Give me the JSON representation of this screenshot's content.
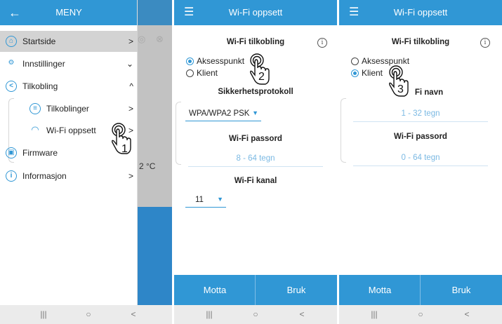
{
  "panel1": {
    "title": "MENY",
    "items": [
      {
        "label": "Startside",
        "chevron": ">",
        "icon": "home-icon",
        "glyph": "⌂"
      },
      {
        "label": "Innstillinger",
        "chevron": "⌄",
        "icon": "settings-icon",
        "glyph": "⚙"
      },
      {
        "label": "Tilkobling",
        "chevron": "^",
        "icon": "share-icon",
        "glyph": "<"
      },
      {
        "label": "Tilkoblinger",
        "chevron": ">",
        "icon": "list-icon",
        "glyph": "≡"
      },
      {
        "label": "Wi-Fi oppsett",
        "chevron": ">",
        "icon": "wifi-icon",
        "glyph": "◠"
      },
      {
        "label": "Firmware",
        "chevron": "",
        "icon": "firmware-icon",
        "glyph": "▣"
      },
      {
        "label": "Informasjon",
        "chevron": ">",
        "icon": "info-icon",
        "glyph": "i"
      }
    ],
    "background_temp": "2 °C",
    "step": "1"
  },
  "panel2": {
    "title": "Wi-Fi oppsett",
    "section_title": "Wi-Fi tilkobling",
    "radio_options": [
      "Aksesspunkt",
      "Klient"
    ],
    "selected": "Aksesspunkt",
    "security_title": "Sikkerhetsprotokoll",
    "security_value": "WPA/WPA2 PSK",
    "password_title": "Wi-Fi passord",
    "password_placeholder": "8 - 64 tegn",
    "channel_title": "Wi-Fi kanal",
    "channel_value": "11",
    "btn_receive": "Motta",
    "btn_apply": "Bruk",
    "step": "2"
  },
  "panel3": {
    "title": "Wi-Fi oppsett",
    "section_title": "Wi-Fi tilkobling",
    "radio_options": [
      "Aksesspunkt",
      "Klient"
    ],
    "selected": "Klient",
    "name_title": "Fi navn",
    "name_placeholder": "1 - 32 tegn",
    "password_title": "Wi-Fi passord",
    "password_placeholder": "0 - 64 tegn",
    "btn_receive": "Motta",
    "btn_apply": "Bruk",
    "step": "3"
  },
  "navbar": {
    "recents": "|||",
    "home": "○",
    "back": "<"
  },
  "icons": {
    "back_arrow": "←",
    "hamburger": "☰",
    "info": "i"
  },
  "colors": {
    "accent": "#3097d5",
    "active_row": "#d3d3d3",
    "navbar": "#ebebeb"
  }
}
